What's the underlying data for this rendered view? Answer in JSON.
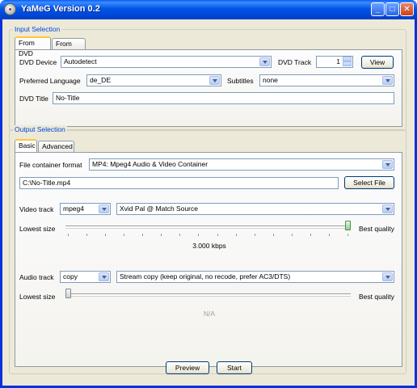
{
  "window": {
    "title": "YaMeG Version 0.2",
    "buttons": {
      "minimize": "_",
      "maximize": "□",
      "close": "✕"
    }
  },
  "input_selection": {
    "title": "Input Selection",
    "tabs": [
      "From DVD",
      "From File"
    ],
    "dvd_device_label": "DVD Device",
    "dvd_device_value": "Autodetect",
    "dvd_track_label": "DVD Track",
    "dvd_track_value": "1",
    "view_button": "View",
    "preferred_language_label": "Preferred Language",
    "preferred_language_value": "de_DE",
    "subtitles_label": "Subtitles",
    "subtitles_value": "none",
    "dvd_title_label": "DVD Title",
    "dvd_title_value": "No-Title"
  },
  "output_selection": {
    "title": "Output Selection",
    "tabs": [
      "Basic",
      "Advanced"
    ],
    "container_label": "File container format",
    "container_value": "MP4: Mpeg4 Audio & Video Container",
    "output_path": "C:\\No-Title.mp4",
    "select_file_button": "Select File",
    "video_track_label": "Video track",
    "video_codec": "mpeg4",
    "video_preset": "Xvid Pal @ Match Source",
    "video_lowest": "Lowest size",
    "video_best": "Best quality",
    "video_quality_level": 1.0,
    "video_bitrate": "3.000 kbps",
    "audio_track_label": "Audio track",
    "audio_codec": "copy",
    "audio_preset": "Stream copy (keep original, no recode, prefer AC3/DTS)",
    "audio_lowest": "Lowest size",
    "audio_best": "Best quality",
    "audio_quality_level": 0.0,
    "audio_bitrate": "N/A"
  },
  "footer": {
    "preview_button": "Preview",
    "start_button": "Start"
  }
}
